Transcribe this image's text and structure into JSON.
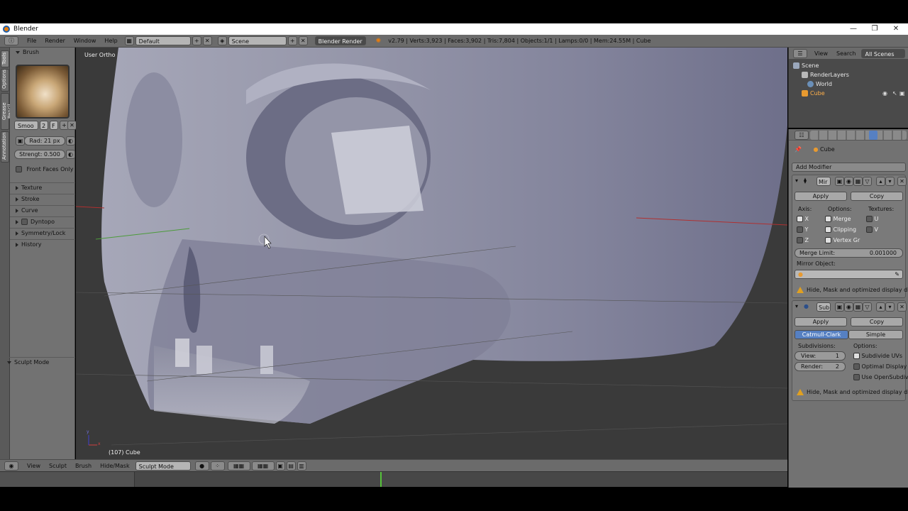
{
  "window": {
    "title": "Blender",
    "min": "—",
    "restore": "❐",
    "close": "✕"
  },
  "infobar": {
    "menus": [
      "File",
      "Render",
      "Window",
      "Help"
    ],
    "layout": "Default",
    "scene": "Scene",
    "engine": "Blender Render",
    "stats": "v2.79 | Verts:3,923 | Faces:3,902 | Tris:7,804 | Objects:1/1 | Lamps:0/0 | Mem:24.55M | Cube"
  },
  "tool_tabs": [
    "Tools",
    "Options",
    "Grease Pencil",
    "Annotation"
  ],
  "toolshelf": {
    "brush_header": "Brush",
    "brush_name": "Smoo",
    "brush_users": "2",
    "fake_user": "F",
    "radius": "Rad: 21 px",
    "strength": "Strengt: 0.500",
    "front_faces": "Front Faces Only",
    "sections": [
      "Texture",
      "Stroke",
      "Curve",
      "Dyntopo",
      "Symmetry/Lock",
      "History"
    ],
    "mode_panel": "Sculpt Mode"
  },
  "viewport": {
    "view_name": "User Ortho",
    "object_label": "(107) Cube",
    "axis_x": "x",
    "axis_y": "y"
  },
  "vp_header": {
    "menus": [
      "View",
      "Sculpt",
      "Brush",
      "Hide/Mask"
    ],
    "mode": "Sculpt Mode"
  },
  "outliner": {
    "menus": [
      "View",
      "Search"
    ],
    "filter": "All Scenes",
    "items": [
      "Scene",
      "RenderLayers",
      "World",
      "Cube"
    ]
  },
  "properties": {
    "object_name": "Cube",
    "add_modifier": "Add Modifier",
    "mirror": {
      "name": "Mir",
      "apply": "Apply",
      "copy": "Copy",
      "axis_label": "Axis:",
      "options_label": "Options:",
      "textures_label": "Textures:",
      "axes": [
        "X",
        "Y",
        "Z"
      ],
      "options": [
        "Merge",
        "Clipping",
        "Vertex Gr"
      ],
      "textures": [
        "U",
        "V"
      ],
      "merge_limit_label": "Merge Limit:",
      "merge_limit_value": "0.001000",
      "mirror_object_label": "Mirror Object:",
      "warning": "Hide, Mask and optimized display disab..."
    },
    "subsurf": {
      "name": "Sub",
      "apply": "Apply",
      "copy": "Copy",
      "tab_catmull": "Catmull-Clark",
      "tab_simple": "Simple",
      "subdivisions_label": "Subdivisions:",
      "options_label": "Options:",
      "view_label": "View:",
      "view_value": "1",
      "render_label": "Render:",
      "render_value": "2",
      "options": [
        "Subdivide UVs",
        "Optimal Display",
        "Use OpenSubdiv"
      ],
      "warning": "Hide, Mask and optimized display disab..."
    }
  },
  "colors": {
    "header": "#6b6b6b",
    "panel": "#727272",
    "viewport": "#3a3a3a",
    "mesh": "#8d8ea4",
    "accent_blue": "#5680c2"
  }
}
